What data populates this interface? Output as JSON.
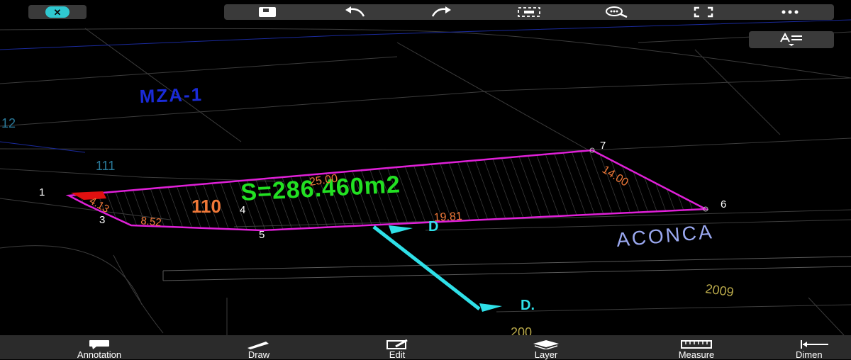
{
  "toolbar": {
    "close_icon": "close-icon",
    "buttons": [
      {
        "id": "save",
        "icon": "save-icon"
      },
      {
        "id": "undo",
        "icon": "undo-icon"
      },
      {
        "id": "redo",
        "icon": "redo-icon"
      },
      {
        "id": "select",
        "icon": "select-area-icon"
      },
      {
        "id": "zoom",
        "icon": "zoom-search-icon"
      },
      {
        "id": "fullscreen",
        "icon": "fullscreen-icon"
      },
      {
        "id": "more",
        "icon": "more-icon"
      }
    ],
    "text_style_icon": "text-style-icon"
  },
  "drawing": {
    "block_label": "MZA-1",
    "lot_number": "110",
    "area_text": "S=286.460m2",
    "street_name": "ACONCA",
    "dimensions": {
      "top": "25.00",
      "right": "14.00",
      "bottom": "19.81",
      "bottom_left": "8.52",
      "left": "4.13"
    },
    "vertices": [
      "1",
      "3",
      "4",
      "5",
      "6",
      "7"
    ],
    "neighbor_numbers": [
      "12",
      "111"
    ],
    "year_labels": [
      "2009",
      "200"
    ],
    "pointer_labels": [
      "D",
      "D."
    ]
  },
  "bottom_nav": [
    {
      "label": "Annotation",
      "icon": "annotation-icon"
    },
    {
      "label": "Draw",
      "icon": "draw-pencil-icon"
    },
    {
      "label": "Edit",
      "icon": "edit-icon"
    },
    {
      "label": "Layer",
      "icon": "layers-icon"
    },
    {
      "label": "Measure",
      "icon": "ruler-icon"
    },
    {
      "label": "Dimen",
      "icon": "dimension-icon"
    }
  ],
  "colors": {
    "background": "#000000",
    "toolbar": "#3a3a3a",
    "accent_cyan": "#2fc8d0",
    "lot_outline": "#e020d8",
    "area_text": "#22e022",
    "dimension_text": "#f07838",
    "block_label": "#1a2bd8",
    "street_label": "#9aa8f0"
  }
}
